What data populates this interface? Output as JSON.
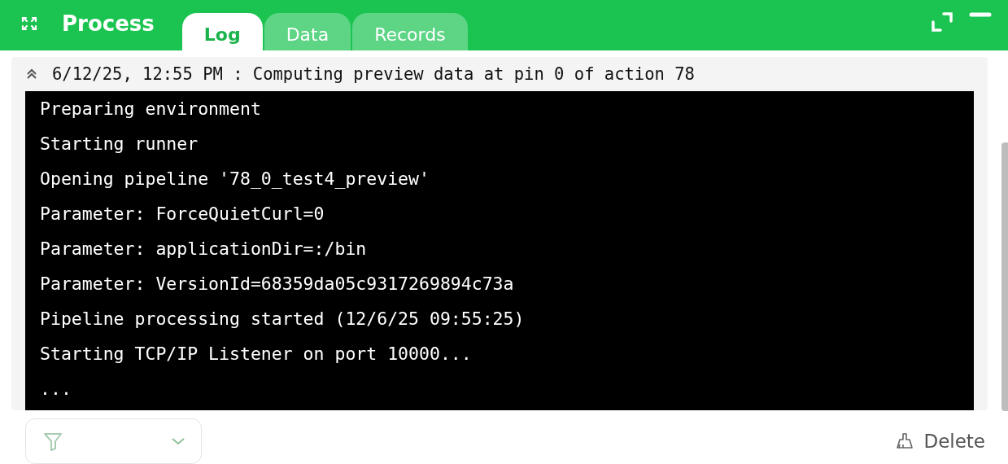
{
  "header": {
    "title": "Process"
  },
  "tabs": [
    {
      "label": "Log",
      "selected": true
    },
    {
      "label": "Data",
      "selected": false
    },
    {
      "label": "Records",
      "selected": false
    }
  ],
  "log": {
    "entry_header": "6/12/25, 12:55 PM : Computing preview data at pin 0 of action 78",
    "expanded": true,
    "lines": [
      "Preparing environment",
      "Starting runner",
      "Opening pipeline '78_0_test4_preview'",
      "Parameter: ForceQuietCurl=0",
      "Parameter: applicationDir=:/bin",
      "Parameter: VersionId=68359da05c9317269894c73a",
      "Pipeline processing started (12/6/25 09:55:25)",
      "Starting TCP/IP Listener on port 10000...",
      "..."
    ]
  },
  "footer": {
    "delete_label": "Delete"
  }
}
